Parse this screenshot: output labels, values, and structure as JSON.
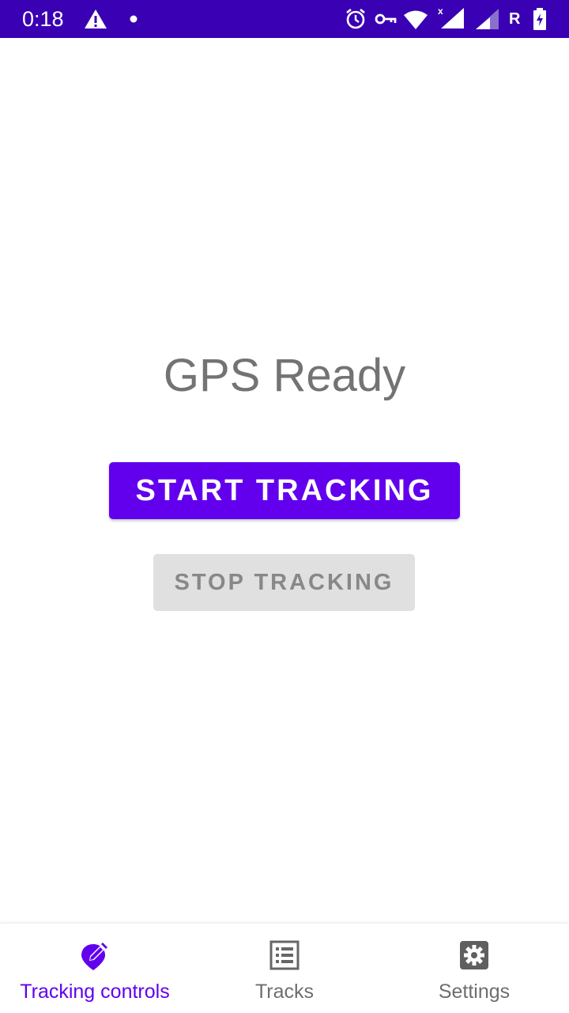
{
  "status_bar": {
    "time": "0:18",
    "carrier_label": "R",
    "icons": [
      "warning-icon",
      "dot-icon",
      "alarm-icon",
      "vpn-key-icon",
      "wifi-icon",
      "signal-icon",
      "signal-icon",
      "battery-charging-icon"
    ],
    "background_color": "#3a00b3"
  },
  "main": {
    "gps_status": "GPS Ready",
    "start_button_label": "START TRACKING",
    "stop_button_label": "STOP TRACKING",
    "accent_color": "#6200ee"
  },
  "bottom_nav": {
    "items": [
      {
        "label": "Tracking controls",
        "icon": "location-edit-icon",
        "active": true
      },
      {
        "label": "Tracks",
        "icon": "list-icon",
        "active": false
      },
      {
        "label": "Settings",
        "icon": "gear-icon",
        "active": false
      }
    ]
  }
}
